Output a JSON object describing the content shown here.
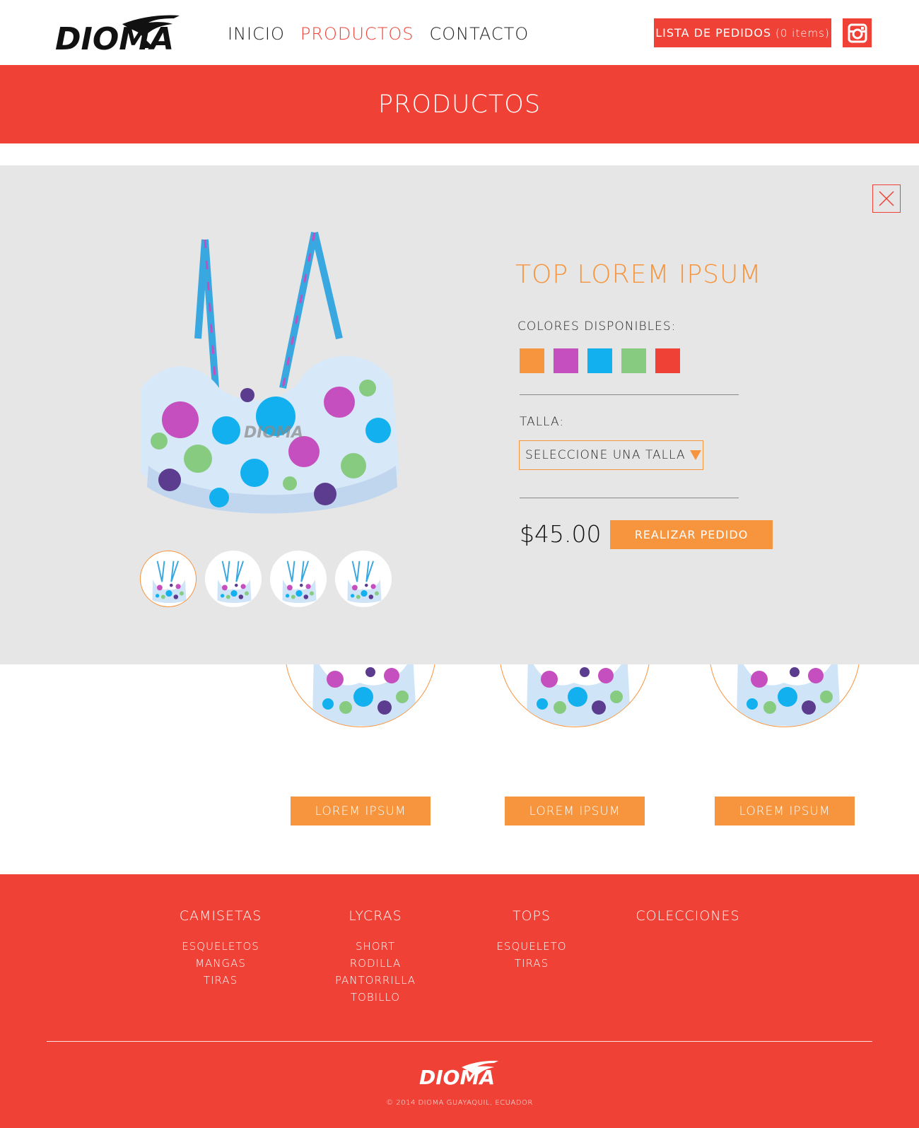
{
  "header": {
    "logo_text": "DIOMA",
    "nav": [
      {
        "label": "INICIO"
      },
      {
        "label": "PRODUCTOS",
        "active": true
      },
      {
        "label": "CONTACTO"
      }
    ],
    "order_list": {
      "label": "LISTA DE PEDIDOS",
      "count": "(0 items)"
    },
    "instagram_icon": "instagram-icon"
  },
  "banner": {
    "title": "PRODUCTOS"
  },
  "modal": {
    "title": "TOP LOREM IPSUM",
    "colors_label": "COLORES DISPONIBLES:",
    "colors": [
      "#f7943e",
      "#c54fbf",
      "#12b0ee",
      "#87cb81",
      "#ef4136"
    ],
    "size_label": "TALLA:",
    "size_placeholder": "SELECCIONE UNA TALLA",
    "price": "$45.00",
    "order_button": "REALIZAR PEDIDO",
    "close_icon": "close-icon"
  },
  "products": [
    {
      "button": "LOREM IPSUM"
    },
    {
      "button": "LOREM IPSUM"
    },
    {
      "button": "LOREM IPSUM"
    }
  ],
  "footer": {
    "columns": [
      {
        "title": "CAMISETAS",
        "links": [
          "ESQUELETOS",
          "MANGAS",
          "TIRAS"
        ]
      },
      {
        "title": "LYCRAS",
        "links": [
          "SHORT",
          "RODILLA",
          "PANTORRILLA",
          "TOBILLO"
        ]
      },
      {
        "title": "TOPS",
        "links": [
          "ESQUELETO",
          "TIRAS"
        ]
      },
      {
        "title": "COLECCIONES",
        "links": []
      }
    ],
    "logo_text": "DIOMA",
    "copyright": "© 2014 DIOMA GUAYAQUIL, ECUADOR"
  },
  "colors": {
    "accent_red": "#ef4136",
    "accent_orange": "#f7943e",
    "modal_bg": "#e6e6e6"
  }
}
